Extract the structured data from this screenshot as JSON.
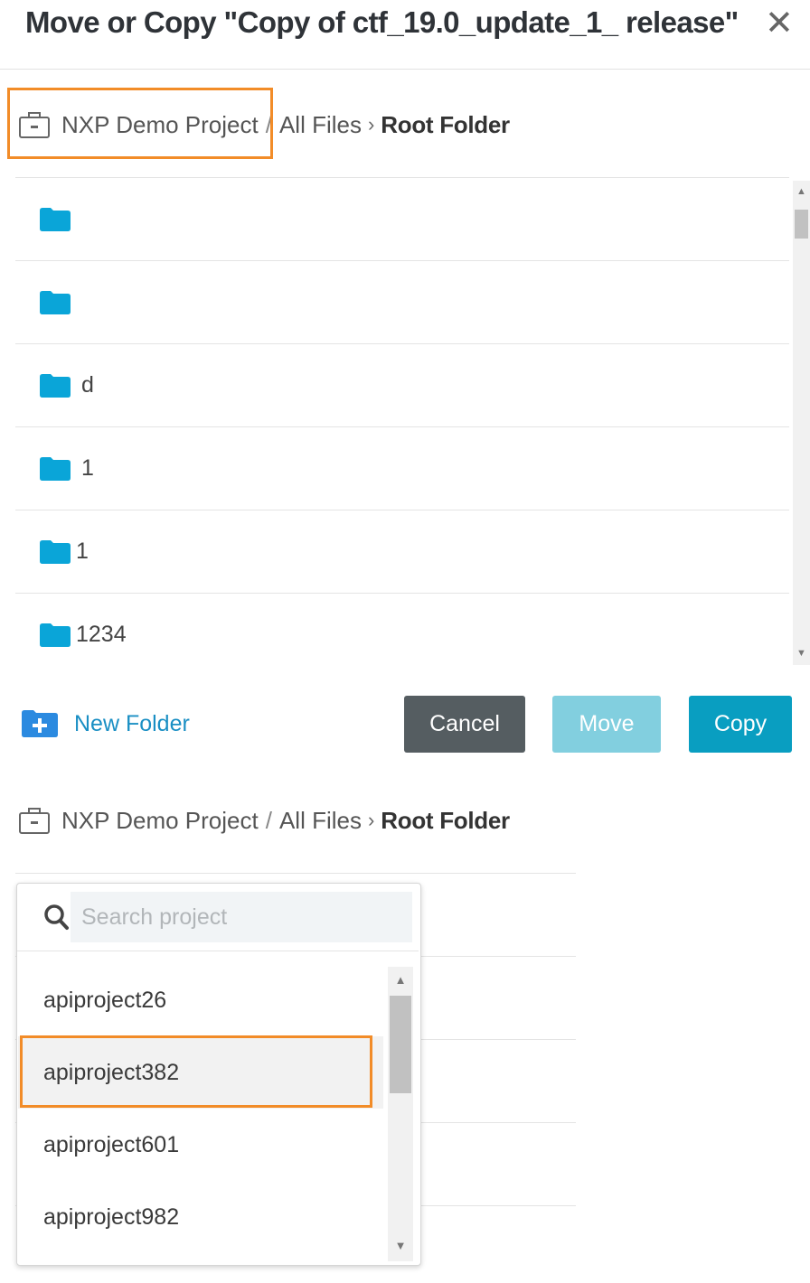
{
  "dialog": {
    "title": "Move or Copy  \"Copy of ctf_19.0_update_1_ release\"",
    "close_glyph": "✕"
  },
  "breadcrumb": {
    "project": "NXP Demo Project",
    "separator": "/",
    "all_files": "All Files",
    "arrow": "›",
    "current": "Root Folder"
  },
  "folders": [
    "",
    "",
    "d",
    "1",
    "1",
    "1234"
  ],
  "actions": {
    "new_folder": "New Folder",
    "cancel": "Cancel",
    "move": "Move",
    "copy": "Copy"
  },
  "project_picker": {
    "search_placeholder": "Search project",
    "projects": [
      "apiproject26",
      "apiproject382",
      "apiproject601",
      "apiproject982"
    ],
    "selected": "apiproject382"
  },
  "colors": {
    "highlight": "#f28c28",
    "folder": "#0aa5d8",
    "link": "#1a8fc4",
    "cancel": "#555d61",
    "move_disabled": "#82cfdf",
    "copy": "#099ec1"
  },
  "icons": {
    "project": "briefcase-icon",
    "folder": "folder-icon",
    "new_folder": "folder-plus-icon",
    "search": "search-icon",
    "close": "close-icon"
  }
}
